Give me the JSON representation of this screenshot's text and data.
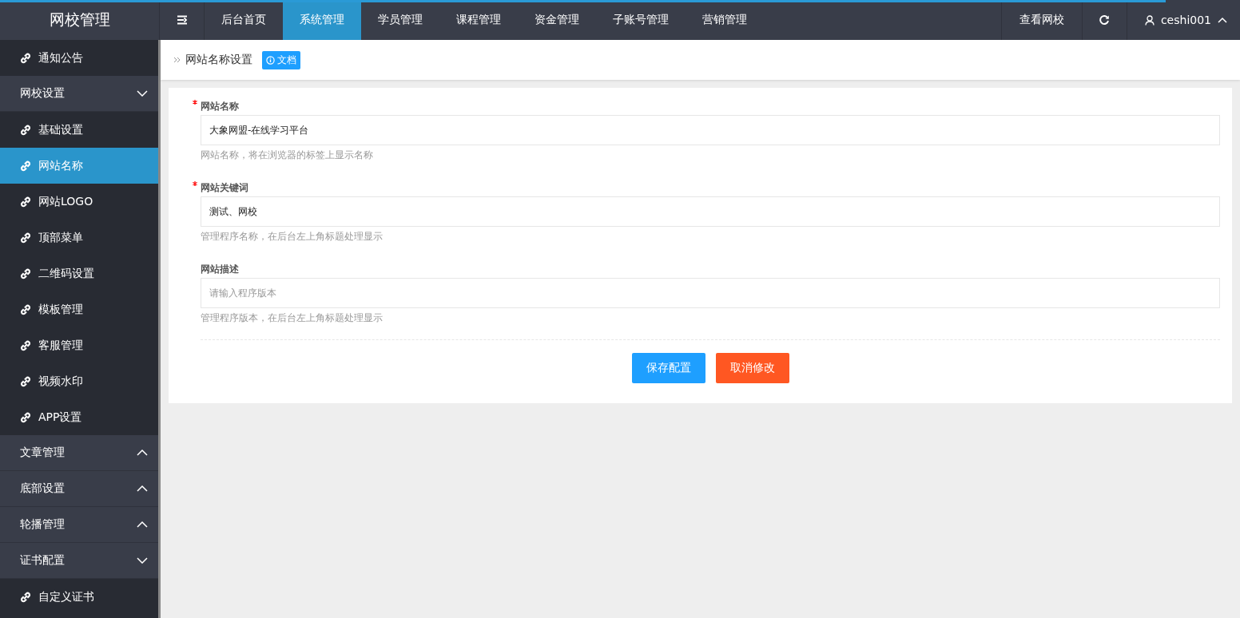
{
  "header": {
    "logo": "网校管理",
    "loading": {
      "level": 0.94
    },
    "nav": [
      {
        "label": "后台首页",
        "selected": false
      },
      {
        "label": "系统管理",
        "selected": true
      },
      {
        "label": "学员管理",
        "selected": false
      },
      {
        "label": "课程管理",
        "selected": false
      },
      {
        "label": "资金管理",
        "selected": false
      },
      {
        "label": "子账号管理",
        "selected": false
      },
      {
        "label": "营销管理",
        "selected": false
      }
    ],
    "view_site": "查看网校",
    "user": "ceshi001"
  },
  "sidebar": {
    "items": [
      {
        "kind": "link",
        "label": "通知公告",
        "selected": false
      },
      {
        "kind": "group",
        "label": "网校设置",
        "expanded": true,
        "children": [
          {
            "label": "基础设置",
            "selected": false
          },
          {
            "label": "网站名称",
            "selected": true
          },
          {
            "label": "网站LOGO",
            "selected": false
          },
          {
            "label": "顶部菜单",
            "selected": false
          },
          {
            "label": "二维码设置",
            "selected": false
          },
          {
            "label": "模板管理",
            "selected": false
          },
          {
            "label": "客服管理",
            "selected": false
          },
          {
            "label": "视频水印",
            "selected": false
          },
          {
            "label": "APP设置",
            "selected": false
          }
        ]
      },
      {
        "kind": "group",
        "label": "文章管理",
        "expanded": false
      },
      {
        "kind": "group",
        "label": "底部设置",
        "expanded": false
      },
      {
        "kind": "group",
        "label": "轮播管理",
        "expanded": false
      },
      {
        "kind": "group",
        "label": "证书配置",
        "expanded": true,
        "children": [
          {
            "label": "自定义证书",
            "selected": false
          }
        ]
      }
    ]
  },
  "breadcrumb": {
    "title": "网站名称设置",
    "doc_badge": "文档"
  },
  "form": {
    "fields": [
      {
        "label": "网站名称",
        "required": true,
        "value": "大象网盟-在线学习平台",
        "hint": "网站名称，将在浏览器的标签上显示名称"
      },
      {
        "label": "网站关键词",
        "required": true,
        "value": "测试、网校",
        "hint": "管理程序名称，在后台左上角标题处理显示"
      },
      {
        "label": "网站描述",
        "required": false,
        "placeholder": "请输入程序版本",
        "hint": "管理程序版本，在后台左上角标题处理显示"
      }
    ],
    "save": "保存配置",
    "cancel": "取消修改"
  }
}
